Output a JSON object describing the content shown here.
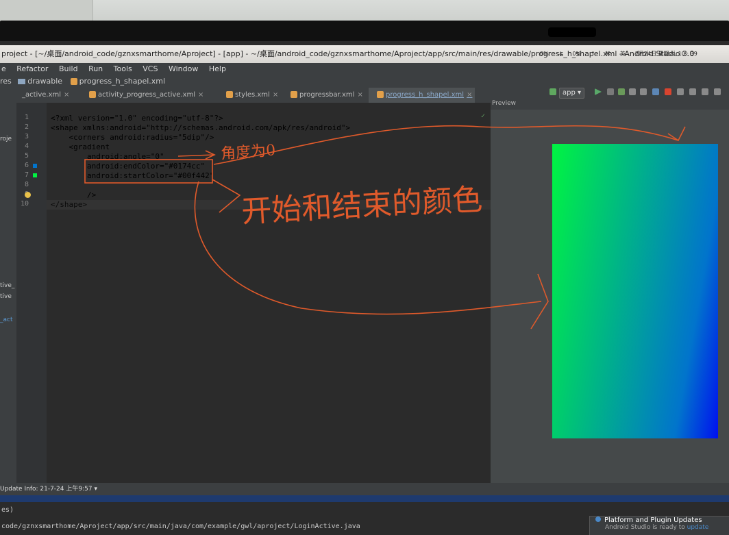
{
  "window": {
    "title": "project - [~/桌面/android_code/gznxsmarthome/Aproject] - [app] - ~/桌面/android_code/gznxsmarthome/Aproject/app/src/main/res/drawable/progress_h_shapel.xml - Android Studio 3.0",
    "sys_items": [
      "0%",
      "↓",
      "0%",
      "↑",
      "⌘",
      "英",
      "7月24日 星期六, 10 : 39"
    ]
  },
  "menu": [
    "Refactor",
    "Build",
    "Run",
    "Tools",
    "VCS",
    "Window",
    "Help"
  ],
  "menu_lead": "e",
  "nav": {
    "prefix": "res",
    "folder": "drawable",
    "file": "progress_h_shapel.xml"
  },
  "tabs": [
    {
      "label": "_active.xml",
      "active": false
    },
    {
      "label": "activity_progress_active.xml",
      "active": false
    },
    {
      "label": "styles.xml",
      "active": false
    },
    {
      "label": "progressbar.xml",
      "active": false
    },
    {
      "label": "progress_h_shapel.xml",
      "active": true
    }
  ],
  "toolbar": {
    "app_selector": "app ▾",
    "preview_label": "Preview"
  },
  "left_tool": [
    "roje",
    "tive_",
    "tive",
    "_act"
  ],
  "editor": {
    "line_numbers": [
      "1",
      "2",
      "3",
      "4",
      "5",
      "6",
      "7",
      "8",
      "9",
      "10"
    ],
    "lines": [
      "<?xml version=\"1.0\" encoding=\"utf-8\"?>",
      "<shape xmlns:android=\"http://schemas.android.com/apk/res/android\">",
      "    <corners android:radius=\"5dip\"/>",
      "    <gradient",
      "        android:angle=\"0\"",
      "        android:endColor=\"#0174cc\"",
      "        android:startColor=\"#00f442\"",
      "",
      "        />",
      "</shape>"
    ]
  },
  "preview": {
    "gradient_start": "#00f442",
    "gradient_end": "#0174cc"
  },
  "status": {
    "text": "Update Info: 21-7-24 上午9:57 ▾"
  },
  "console": [
    "es)",
    "code/gznxsmarthome/Aproject/app/src/main/java/com/example/gwl/aproject/LoginActive.java"
  ],
  "notification": {
    "title": "Platform and Plugin Updates",
    "body": "Android Studio is ready to",
    "link": "update"
  },
  "annotations": {
    "angle_note": "角度为0",
    "colors_note": "开始和结束的颜色"
  }
}
